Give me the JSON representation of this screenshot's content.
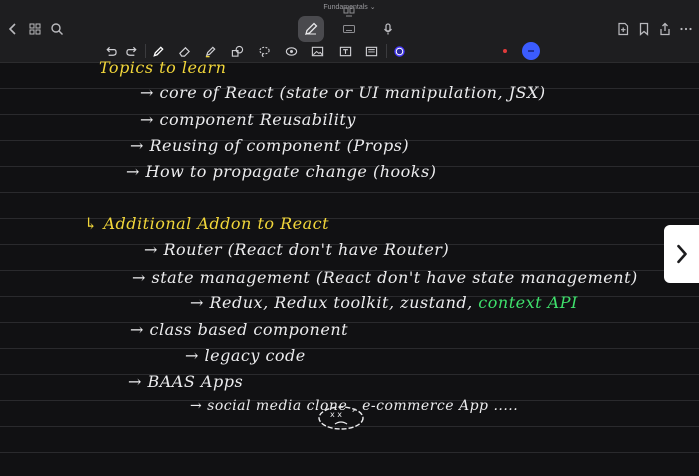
{
  "document": {
    "title": "Fundamentals ⌄"
  },
  "nav_icons": [
    "back-chevron-icon",
    "grid-icon",
    "search-icon",
    "page-thumbnails-icon",
    "pen-tool-icon",
    "keyboard-icon",
    "microphone-icon",
    "add-page-icon",
    "bookmark-icon",
    "grid-view-icon",
    "share-icon",
    "more-icon"
  ],
  "toolbar_icons": [
    "undo-icon",
    "redo-icon",
    "pen-icon",
    "eraser-icon",
    "highlighter-icon",
    "shapes-icon",
    "lasso-icon",
    "element-icon",
    "image-icon",
    "text-box-icon",
    "sticker-icon",
    "color-picker-icon"
  ],
  "colors": {
    "accent": "#4a3cff",
    "yellow_ink": "#f1d63a",
    "green_ink": "#3fe06c",
    "white_ink": "#ececee",
    "red_dot": "#e03b3b",
    "blue_dot": "#3b5cff"
  },
  "notes": {
    "topics_heading": "Topics to learn",
    "core": "→ core of React (state or UI manipulation, JSX)",
    "reusability": "→ component Reusability",
    "reusing": "→ Reusing of component (Props)",
    "propagate": "→ How to propagate change (hooks)",
    "addon_heading": "↳ Additional Addon to React",
    "router": "→ Router (React don't have Router)",
    "state_mgmt": "→ state management (React don't have state management)",
    "redux_prefix": "→ Redux, Redux toolkit, zustand,",
    "context_api": "context API",
    "class_based": "→ class based component",
    "legacy": "→ legacy code",
    "baas": "→ BAAS Apps",
    "social": "→ social media clone , e-commerce App .....",
    "face_eyes": "x x"
  }
}
